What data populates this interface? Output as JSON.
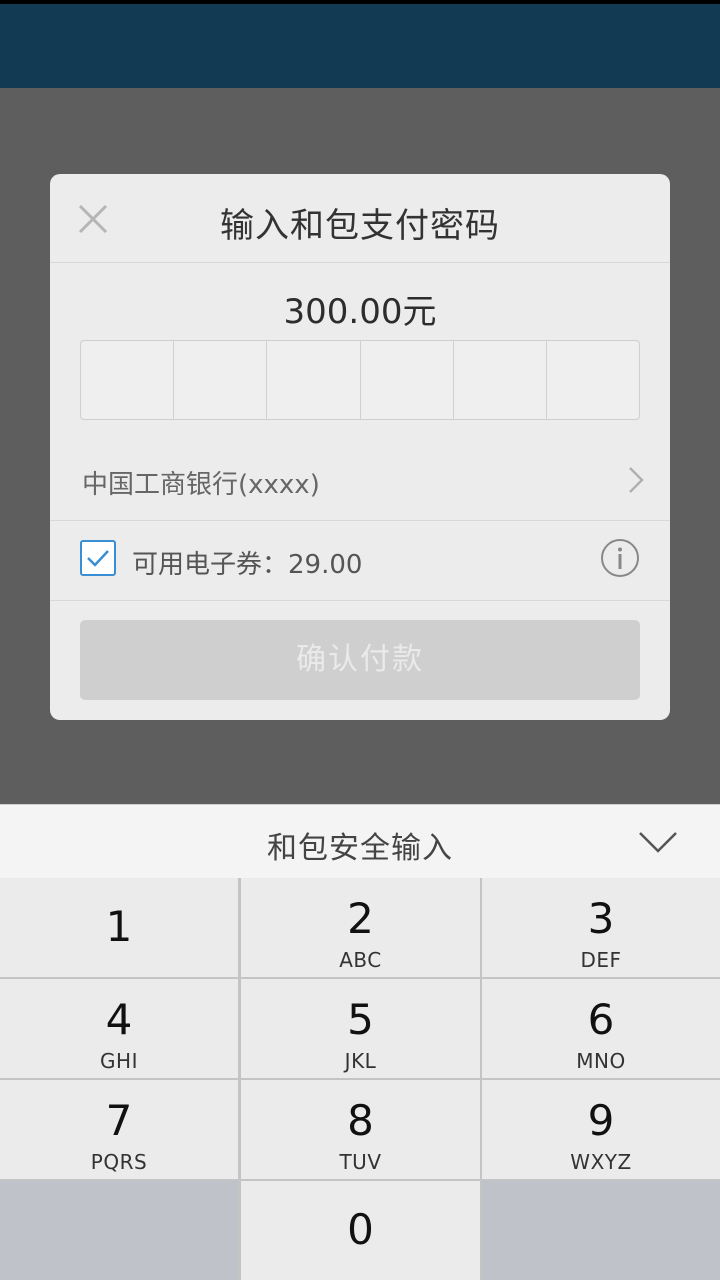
{
  "dialog": {
    "title": "输入和包支付密码",
    "amount": "300.00元",
    "pin_length": 6,
    "bank": "中国工商银行(xxxx)",
    "coupon": {
      "checked": true,
      "label": "可用电子券：29.00"
    },
    "confirm_label": "确认付款"
  },
  "keyboard": {
    "title": "和包安全输入",
    "keys": [
      {
        "digit": "1",
        "letters": ""
      },
      {
        "digit": "2",
        "letters": "ABC"
      },
      {
        "digit": "3",
        "letters": "DEF"
      },
      {
        "digit": "4",
        "letters": "GHI"
      },
      {
        "digit": "5",
        "letters": "JKL"
      },
      {
        "digit": "6",
        "letters": "MNO"
      },
      {
        "digit": "7",
        "letters": "PQRS"
      },
      {
        "digit": "8",
        "letters": "TUV"
      },
      {
        "digit": "9",
        "letters": "WXYZ"
      },
      {
        "digit": "",
        "letters": ""
      },
      {
        "digit": "0",
        "letters": ""
      },
      {
        "digit": "",
        "letters": ""
      }
    ]
  },
  "colors": {
    "header_bg": "#123a52",
    "overlay": "#5e5e5e",
    "checkbox_accent": "#3a8ed4",
    "confirm_disabled": "#cfcfcf"
  },
  "icons": {
    "close": "close-icon",
    "bank_chevron": "chevron-right-icon",
    "checkbox": "checkmark-icon",
    "info": "info-icon",
    "keyboard_collapse": "chevron-down-icon"
  }
}
